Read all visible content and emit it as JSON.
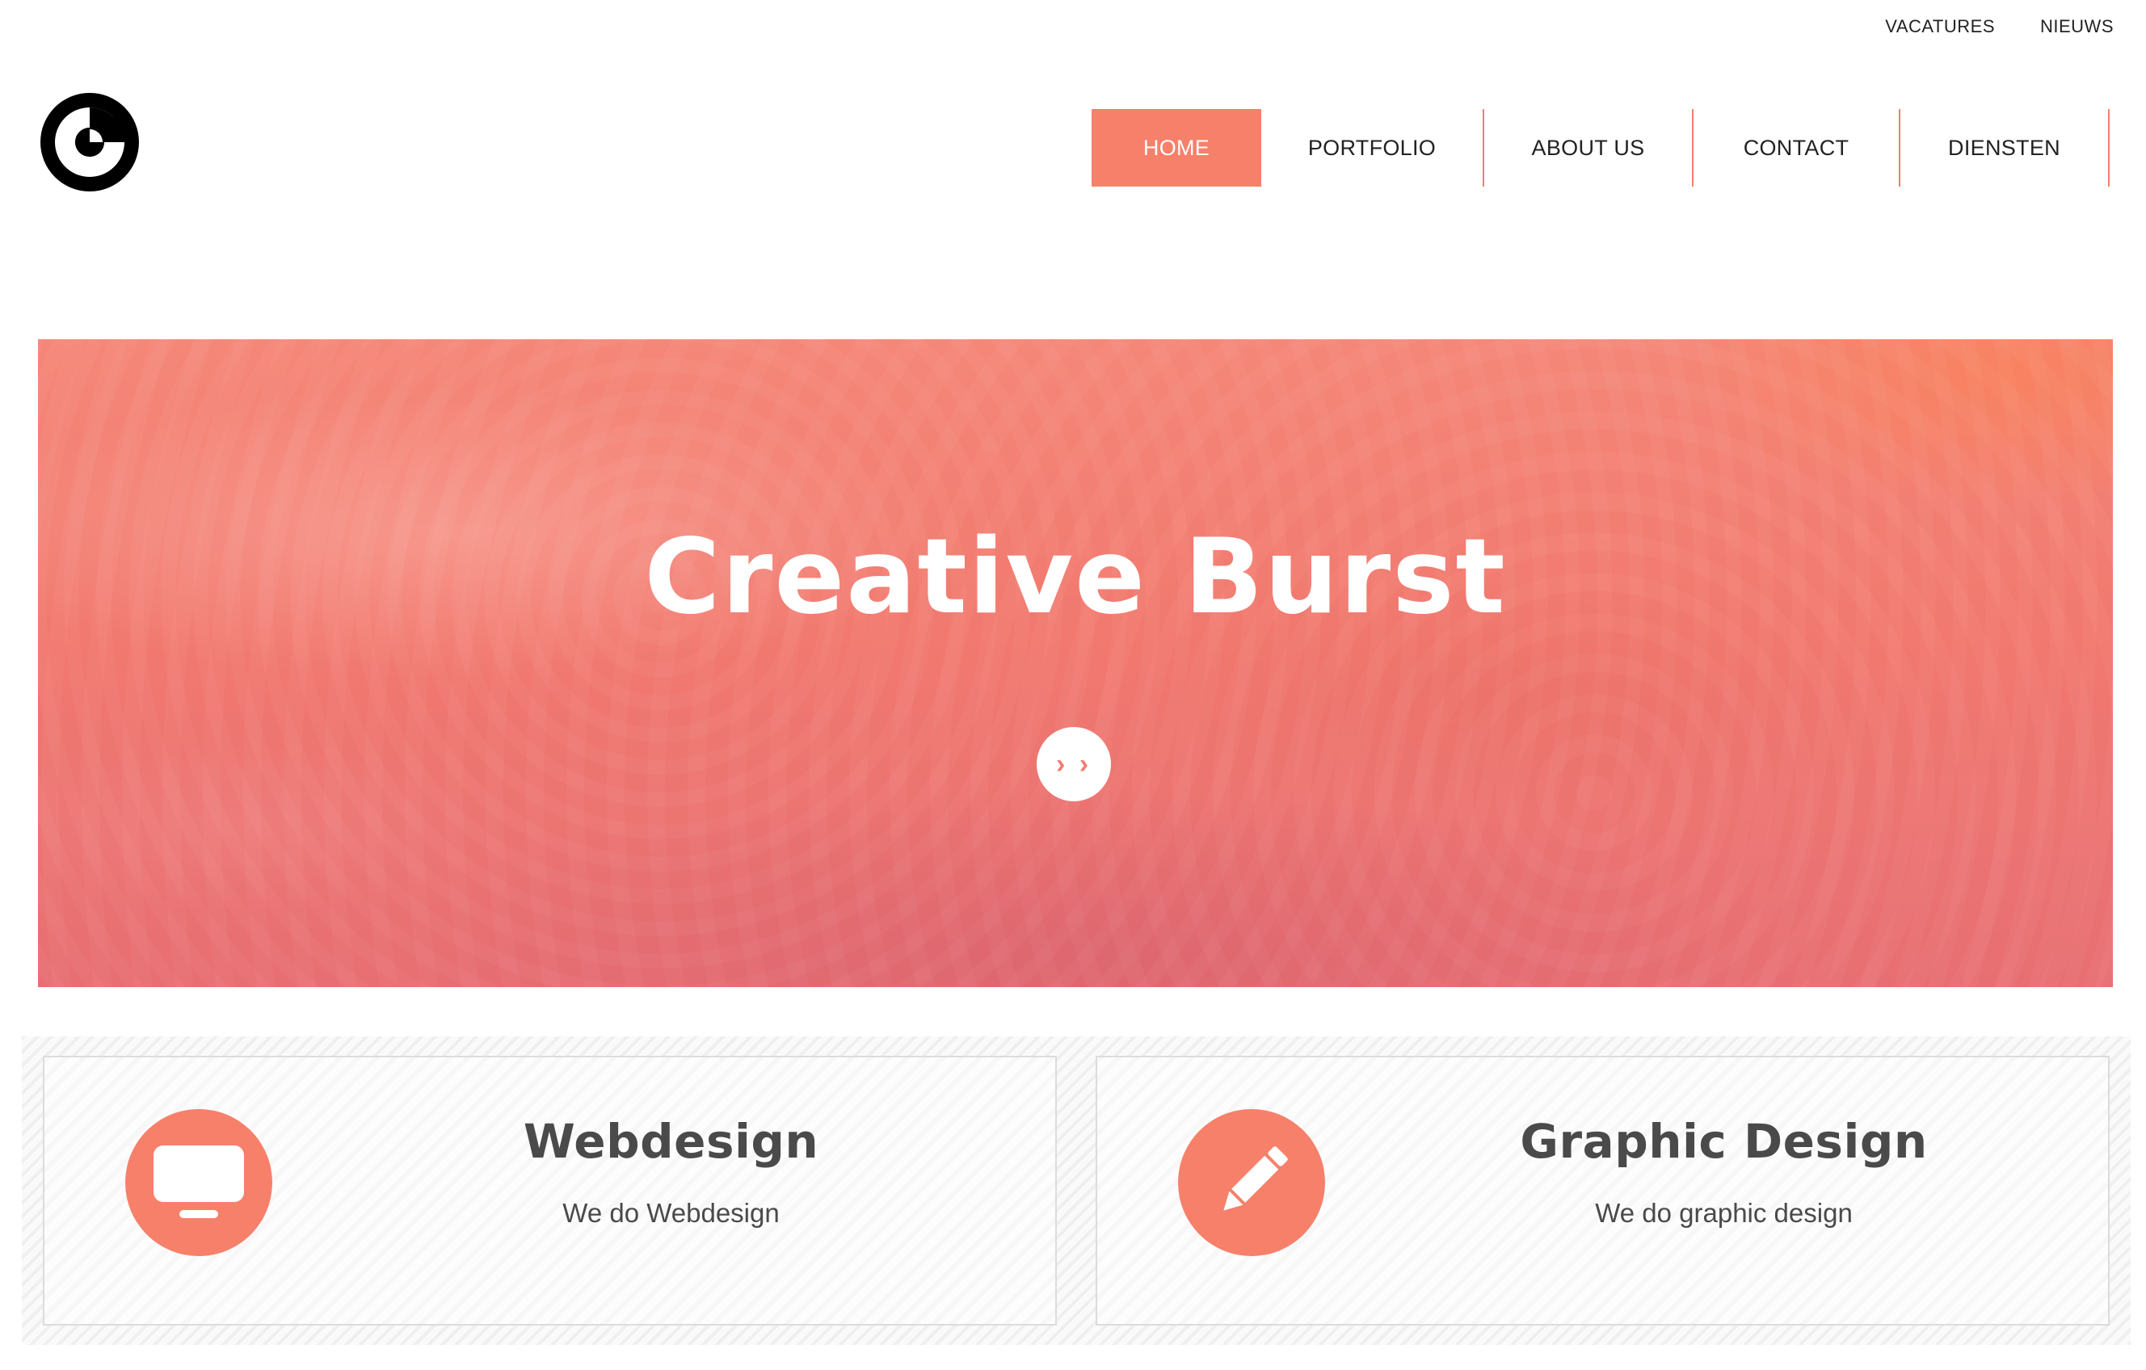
{
  "utility_links": [
    "VACATURES",
    "NIEUWS"
  ],
  "nav": {
    "items": [
      "HOME",
      "PORTFOLIO",
      "ABOUT US",
      "CONTACT",
      "DIENSTEN"
    ],
    "active": "HOME"
  },
  "hero": {
    "title": "Creative Burst",
    "next_icon": "double-chevron-right-icon",
    "next_glyph": "› ›"
  },
  "services": [
    {
      "title": "Webdesign",
      "subtitle": "We do Webdesign",
      "icon": "monitor-icon"
    },
    {
      "title": "Graphic Design",
      "subtitle": "We do graphic design",
      "icon": "pencil-icon"
    }
  ],
  "colors": {
    "accent": "#f7806b",
    "text_dark": "#222222",
    "heading_gray": "#4a4a4a"
  }
}
